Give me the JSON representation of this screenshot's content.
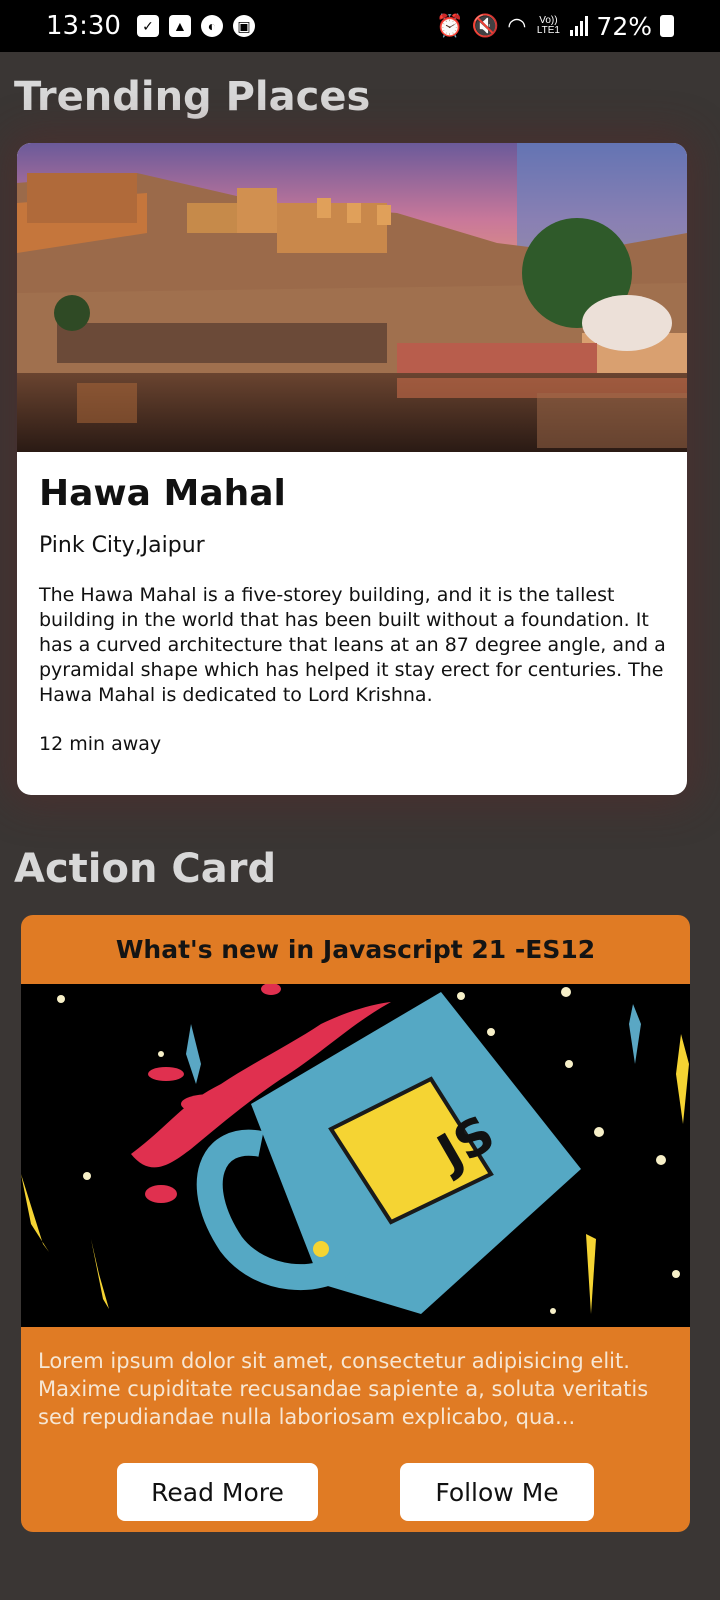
{
  "status_bar": {
    "time": "13:30",
    "battery": "72%",
    "network_label": "Vo)) LTE1"
  },
  "sections": {
    "trending_title": "Trending Places",
    "action_title": "Action Card"
  },
  "place_card": {
    "name": "Hawa Mahal",
    "location": "Pink City,Jaipur",
    "description": "The Hawa Mahal is a five-storey building, and it is the tallest building in the world that has been built without a foundation. It has a curved architecture that leans at an 87 degree angle, and a pyramidal shape which has helped it stay erect for centuries. The Hawa Mahal is dedicated to Lord Krishna.",
    "distance": "12 min away"
  },
  "action_card": {
    "header": "What's new in Javascript 21 -ES12",
    "image_label": "JS",
    "body": "Lorem ipsum dolor sit amet, consectetur adipisicing elit. Maxime cupiditate recusandae sapiente a, soluta veritatis sed repudiandae nulla laboriosam explicabo, qua...",
    "read_more_label": "Read More",
    "follow_label": "Follow Me"
  },
  "colors": {
    "action_card_bg": "#e07b24",
    "page_bg": "#3a3634"
  }
}
